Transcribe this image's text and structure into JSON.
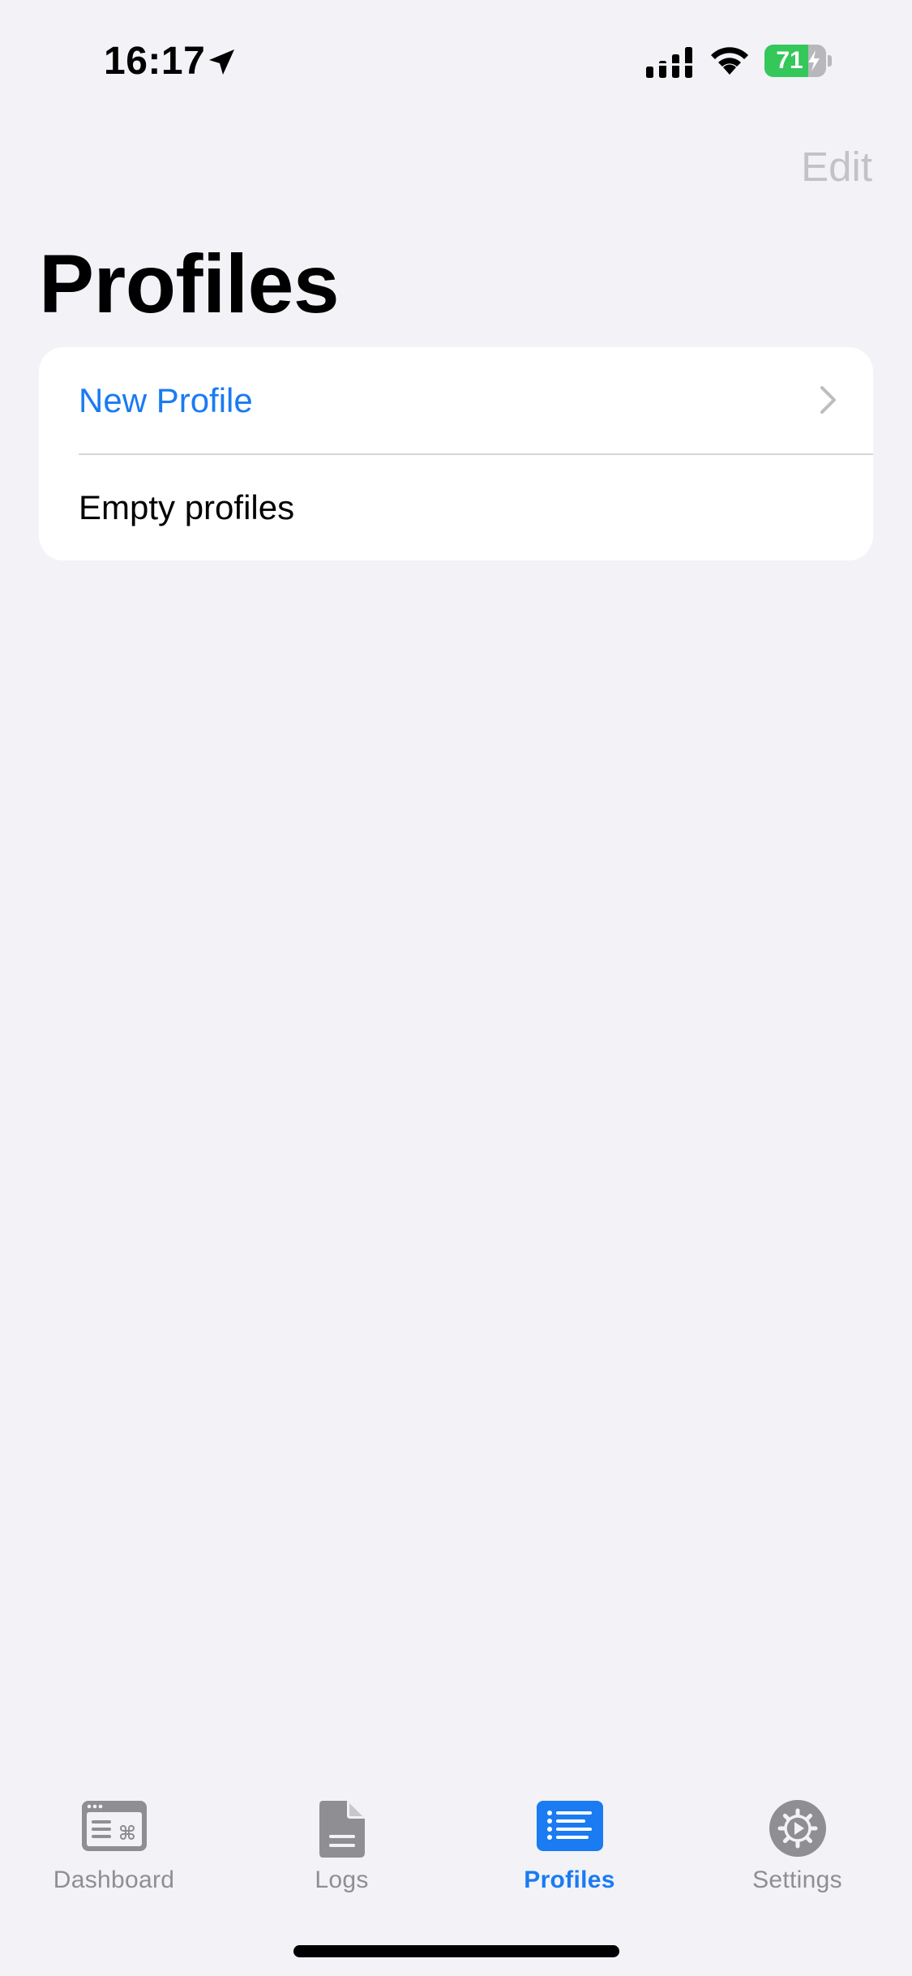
{
  "status_bar": {
    "time": "16:17",
    "battery_percent": "71",
    "battery_level": 0.71,
    "icons": [
      "location-arrow-icon",
      "cellular-signal-icon",
      "wifi-icon",
      "battery-charging-icon"
    ]
  },
  "nav": {
    "edit_label": "Edit",
    "title": "Profiles"
  },
  "list": {
    "rows": [
      {
        "label": "New Profile",
        "accessory": "chevron-right-icon"
      },
      {
        "label": "Empty profiles"
      }
    ]
  },
  "tab_bar": {
    "tabs": [
      {
        "label": "Dashboard",
        "icon": "dashboard-icon",
        "active": false
      },
      {
        "label": "Logs",
        "icon": "document-icon",
        "active": false
      },
      {
        "label": "Profiles",
        "icon": "list-icon",
        "active": true
      },
      {
        "label": "Settings",
        "icon": "gear-icon",
        "active": false
      }
    ]
  },
  "colors": {
    "accent": "#1a7bf2",
    "background": "#f2f2f7",
    "inactive_tab": "#8e8e93",
    "battery_green": "#34c759"
  }
}
